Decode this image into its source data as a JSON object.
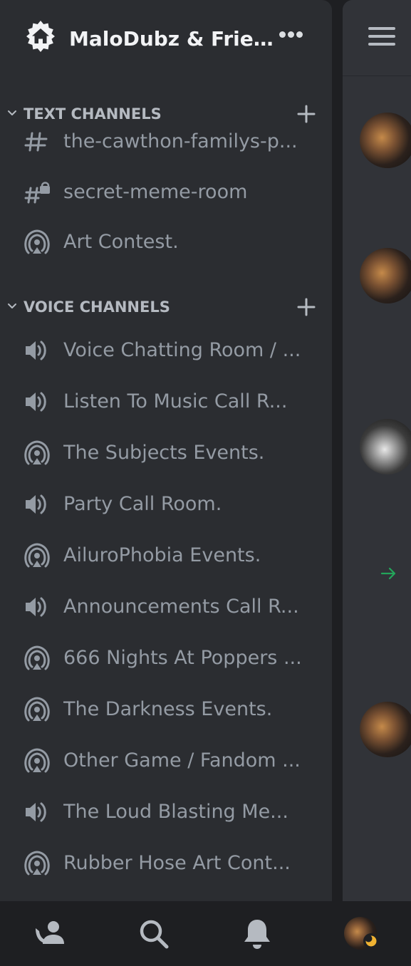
{
  "server": {
    "name": "MaloDubz & Frie...",
    "icon": "home-icon",
    "menu_icon": "more-icon"
  },
  "categories": [
    {
      "label": "TEXT CHANNELS",
      "channels": [
        {
          "name": "the-cawthon-familys-p...",
          "icon": "text-channel-icon"
        },
        {
          "name": "secret-meme-room",
          "icon": "locked-text-channel-icon"
        },
        {
          "name": "Art Contest.",
          "icon": "stage-channel-icon"
        }
      ]
    },
    {
      "label": "VOICE CHANNELS",
      "channels": [
        {
          "name": "Voice Chatting Room / ...",
          "icon": "voice-channel-icon"
        },
        {
          "name": "Listen To Music Call R...",
          "icon": "voice-channel-icon"
        },
        {
          "name": "The Subjects Events.",
          "icon": "stage-channel-icon"
        },
        {
          "name": "Party Call Room.",
          "icon": "voice-channel-icon"
        },
        {
          "name": "AiluroPhobia Events.",
          "icon": "stage-channel-icon"
        },
        {
          "name": "Announcements Call R...",
          "icon": "voice-channel-icon"
        },
        {
          "name": "666 Nights At Poppers ...",
          "icon": "stage-channel-icon"
        },
        {
          "name": "The Darkness Events.",
          "icon": "stage-channel-icon"
        },
        {
          "name": "Other Game / Fandom ...",
          "icon": "stage-channel-icon"
        },
        {
          "name": "The Loud Blasting Me...",
          "icon": "voice-channel-icon"
        },
        {
          "name": "Rubber Hose Art Cont...",
          "icon": "stage-channel-icon"
        }
      ]
    }
  ],
  "bottom_nav": [
    "friends-icon",
    "search-icon",
    "notifications-icon",
    "profile-avatar"
  ],
  "colors": {
    "sidebar_bg": "#2b2d31",
    "chat_bg": "#313338",
    "nav_bg": "#1e1f22",
    "channel_text": "#949ba4",
    "header_text": "#f2f3f5",
    "join_arrow": "#23a55a",
    "idle_status": "#f0b232"
  }
}
